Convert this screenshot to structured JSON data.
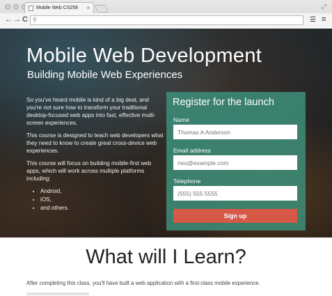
{
  "browser": {
    "tab_title": "Mobile Web CS256",
    "tab_close": "×",
    "url": "",
    "nav": {
      "back": "←",
      "forward": "→",
      "reload": "C"
    },
    "icons": {
      "search": "search-icon",
      "extension": "stack-icon",
      "menu": "menu-icon"
    }
  },
  "hero": {
    "title": "Mobile Web Development",
    "subtitle": "Building Mobile Web Experiences",
    "paragraphs": [
      "So you've heard mobile is kind of a big deal, and you're not sure how to transform your traditional desktop-focused web apps into fast, effective multi-screen experiences.",
      "This course is designed to teach web developers what they need to know to create great cross-device web experiences.",
      "This course will focus on building mobile-first web apps, which will work across multiple platforms including:"
    ],
    "platforms": [
      "Android,",
      "iOS,",
      "and others."
    ]
  },
  "form": {
    "title": "Register for the launch",
    "name_label": "Name",
    "name_placeholder": "Thomas A Anderson",
    "email_label": "Email address",
    "email_placeholder": "neo@example.com",
    "phone_label": "Telephone",
    "phone_placeholder": "(555) 555 5555",
    "submit_label": "Sign up",
    "colors": {
      "panel": "#3c8c78",
      "button": "#d65846"
    }
  },
  "learn": {
    "title": "What will I Learn?",
    "text": "After completing this class, you'll have built a web application with a first-class mobile experience."
  }
}
